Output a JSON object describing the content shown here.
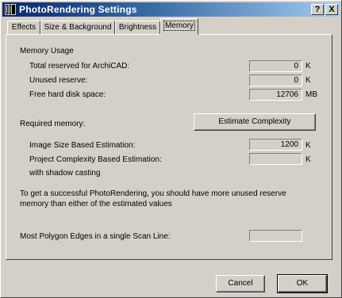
{
  "window": {
    "title": "PhotoRendering Settings",
    "help_label": "?",
    "close_label": "X"
  },
  "tabs": [
    {
      "label": "Effects"
    },
    {
      "label": "Size & Background"
    },
    {
      "label": "Brightness"
    },
    {
      "label": "Memory",
      "selected": true
    }
  ],
  "memory_usage": {
    "heading": "Memory Usage",
    "total_label": "Total reserved for ArchiCAD:",
    "total_value": "0",
    "total_unit": "K",
    "unused_label": "Unused reserve:",
    "unused_value": "0",
    "unused_unit": "K",
    "disk_label": "Free hard disk space:",
    "disk_value": "12706",
    "disk_unit": "MB"
  },
  "required": {
    "label": "Required memory:",
    "estimate_button": "Estimate Complexity",
    "image_label": "Image Size Based Estimation:",
    "image_value": "1200",
    "image_unit": "K",
    "project_label": "Project Complexity Based Estimation:",
    "project_value": "",
    "project_unit": "K",
    "shadow_label": "with shadow casting"
  },
  "note": "To get a successful PhotoRendering, you should have more unused reserve memory than either of the estimated values",
  "polygon": {
    "label": "Most Polygon Edges in a single Scan Line:",
    "value": ""
  },
  "buttons": {
    "cancel": "Cancel",
    "ok": "OK"
  }
}
